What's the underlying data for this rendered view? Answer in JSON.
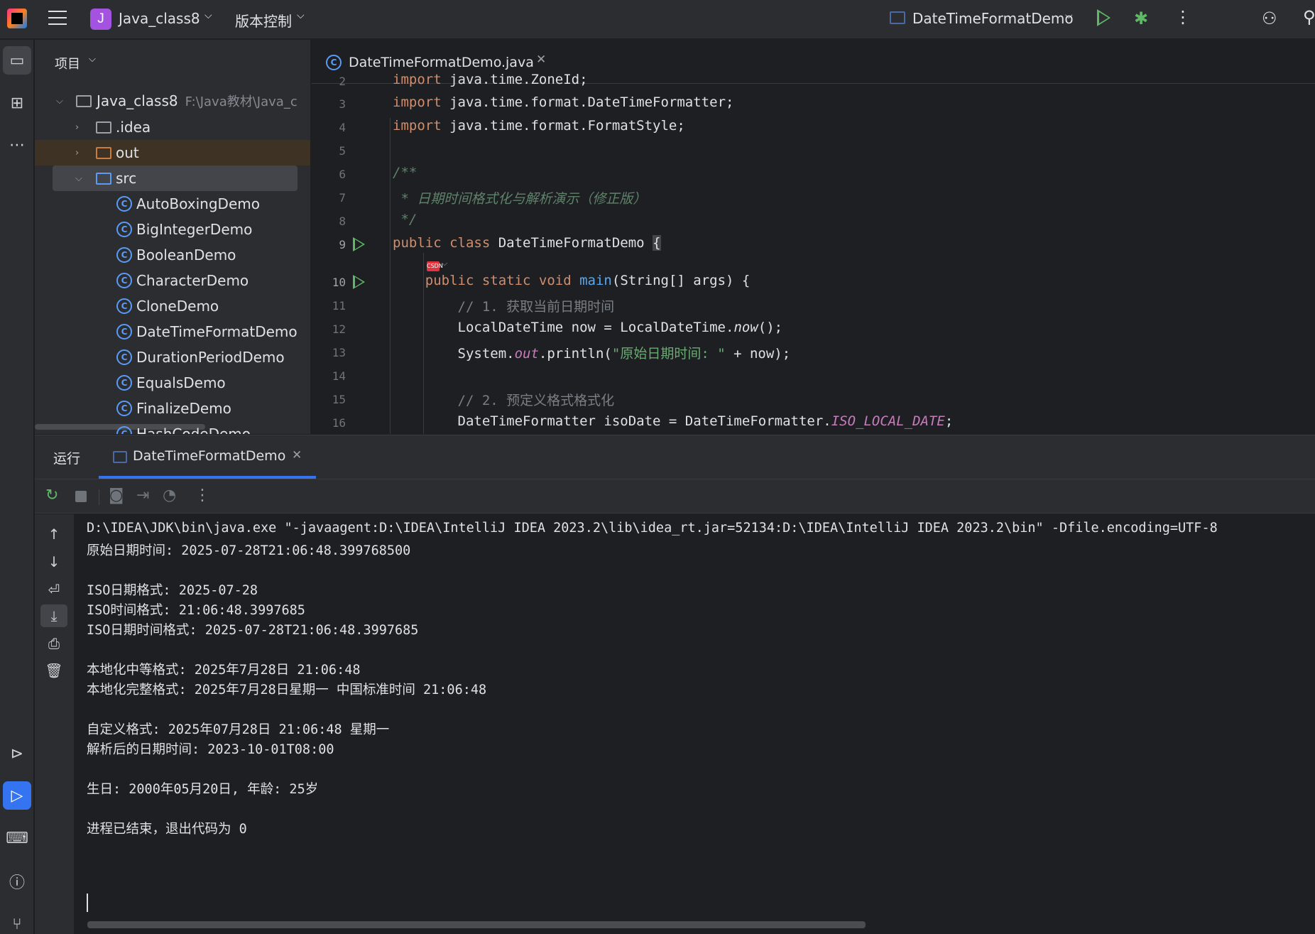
{
  "titlebar": {
    "project_badge": "J",
    "project_name": "Java_class8",
    "vcs_label": "版本控制",
    "run_config": "DateTimeFormatDemo"
  },
  "left_strip": {
    "icons": [
      "folder-icon",
      "structure-icon",
      "more-icon",
      "services-icon",
      "run-icon",
      "terminal-icon",
      "problems-icon",
      "git-icon"
    ]
  },
  "project": {
    "header": "项目",
    "root": {
      "name": "Java_class8",
      "path": "F:\\Java教材\\Java_c"
    },
    "folders": [
      ".idea",
      "out",
      "src"
    ],
    "classes": [
      "AutoBoxingDemo",
      "BigIntegerDemo",
      "BooleanDemo",
      "CharacterDemo",
      "CloneDemo",
      "DateTimeFormatDemo",
      "DurationPeriodDemo",
      "EqualsDemo",
      "FinalizeDemo",
      "HashCodeDemo"
    ]
  },
  "editor": {
    "tab_title": "DateTimeFormatDemo.java",
    "lines": [
      {
        "n": "2",
        "parts": [
          [
            "kw",
            "import "
          ],
          [
            "",
            "java.time.ZoneId;"
          ]
        ]
      },
      {
        "n": "3",
        "parts": [
          [
            "kw",
            "import "
          ],
          [
            "",
            "java.time.format.DateTimeFormatter;"
          ]
        ]
      },
      {
        "n": "4",
        "parts": [
          [
            "kw",
            "import "
          ],
          [
            "",
            "java.time.format.FormatStyle;"
          ]
        ]
      },
      {
        "n": "5",
        "parts": []
      },
      {
        "n": "6",
        "parts": [
          [
            "doc",
            "/**"
          ]
        ]
      },
      {
        "n": "7",
        "parts": [
          [
            "doc",
            " * 日期时间格式化与解析演示（修正版）"
          ]
        ]
      },
      {
        "n": "8",
        "parts": [
          [
            "doc",
            " */"
          ]
        ]
      },
      {
        "n": "9",
        "parts": [
          [
            "kw",
            "public class "
          ],
          [
            "",
            "DateTimeFormatDemo "
          ],
          [
            "brace",
            "{"
          ]
        ]
      },
      {
        "n": "10",
        "parts": [
          [
            "",
            "    "
          ],
          [
            "kw",
            "public static void "
          ],
          [
            "fn",
            "main"
          ],
          [
            "",
            "(String[] args) {"
          ]
        ]
      },
      {
        "n": "11",
        "parts": [
          [
            "cmt",
            "        // 1. 获取当前日期时间"
          ]
        ]
      },
      {
        "n": "12",
        "parts": [
          [
            "",
            "        LocalDateTime now = LocalDateTime."
          ],
          [
            "itl",
            "now"
          ],
          [
            "",
            "();"
          ]
        ]
      },
      {
        "n": "13",
        "parts": [
          [
            "",
            "        System."
          ],
          [
            "fld",
            "out"
          ],
          [
            "",
            ".println("
          ],
          [
            "st",
            "\"原始日期时间: \""
          ],
          [
            "",
            " + now);"
          ]
        ]
      },
      {
        "n": "14",
        "parts": []
      },
      {
        "n": "15",
        "parts": [
          [
            "cmt",
            "        // 2. 预定义格式格式化"
          ]
        ]
      },
      {
        "n": "16",
        "parts": [
          [
            "",
            "        DateTimeFormatter isoDate = DateTimeFormatter."
          ],
          [
            "fld",
            "ISO_LOCAL_DATE"
          ],
          [
            "",
            ";"
          ]
        ]
      }
    ]
  },
  "run": {
    "title": "运行",
    "tab": "DateTimeFormatDemo",
    "console": [
      "D:\\IDEA\\JDK\\bin\\java.exe \"-javaagent:D:\\IDEA\\IntelliJ IDEA 2023.2\\lib\\idea_rt.jar=52134:D:\\IDEA\\IntelliJ IDEA 2023.2\\bin\" -Dfile.encoding=UTF-8",
      "原始日期时间: 2025-07-28T21:06:48.399768500",
      "",
      "ISO日期格式: 2025-07-28",
      "ISO时间格式: 21:06:48.3997685",
      "ISO日期时间格式: 2025-07-28T21:06:48.3997685",
      "",
      "本地化中等格式: 2025年7月28日 21:06:48",
      "本地化完整格式: 2025年7月28日星期一 中国标准时间 21:06:48",
      "",
      "自定义格式: 2025年07月28日 21:06:48 星期一",
      "解析后的日期时间: 2023-10-01T08:00",
      "",
      "生日: 2000年05月20日, 年龄: 25岁",
      "",
      "进程已结束，退出代码为 0"
    ]
  },
  "colors": {
    "accent": "#3574f0",
    "run_green": "#5fb865",
    "bg_panel": "#2b2d30",
    "bg_editor": "#1e1f22"
  }
}
